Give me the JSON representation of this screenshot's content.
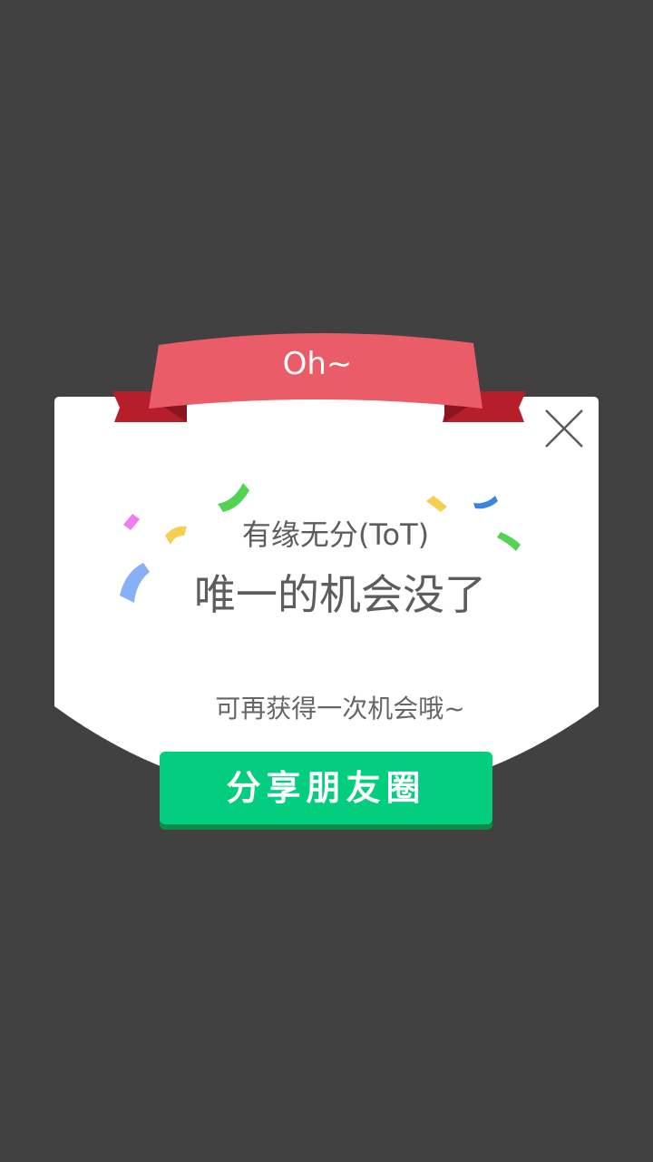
{
  "dialog": {
    "ribbon_title": "Oh~",
    "subtitle": "有缘无分(ToT)",
    "headline": "唯一的机会没了",
    "hint": "可再获得一次机会哦~",
    "share_button_label": "分享朋友圈",
    "close_icon": "close-icon"
  },
  "colors": {
    "background": "#414141",
    "card": "#ffffff",
    "ribbon": "#e95c68",
    "ribbon_fold": "#b71e2b",
    "button": "#03cd7e",
    "button_shadow": "#0d8a4a",
    "text": "#5d5d5d"
  }
}
